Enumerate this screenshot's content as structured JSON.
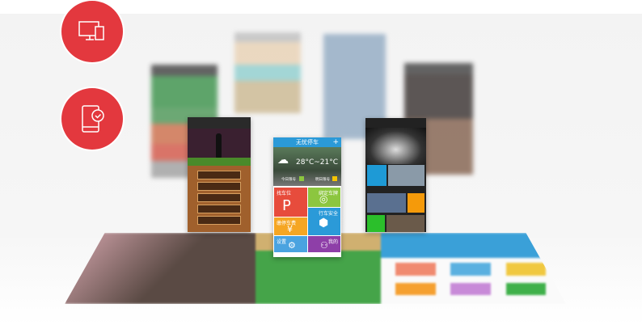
{
  "icons": {
    "multi_device": "monitor-phone-icon",
    "mobile_check": "phone-check-icon"
  },
  "colors": {
    "accent": "#e3383e",
    "blue": "#2b9ad8",
    "red": "#e74c3c",
    "green": "#8cc63f",
    "orange": "#f5a623",
    "purple": "#8e3fa8",
    "sky": "#3aa3e3"
  },
  "parking_app": {
    "title": "无忧停车",
    "plus": "+",
    "temperature": "28°C~21°C",
    "today_limit_label": "今日限号",
    "tomorrow_limit_label": "明日限号",
    "tiles": [
      {
        "label": "找车位",
        "icon": "P"
      },
      {
        "label": "绑定车牌",
        "icon": "◎"
      },
      {
        "label": "行车安全",
        "icon": "⬢"
      },
      {
        "label": "缴停车费",
        "icon": "¥"
      },
      {
        "label": "设置",
        "icon": "⚙"
      },
      {
        "label": "我的",
        "icon": "⚇"
      }
    ]
  }
}
